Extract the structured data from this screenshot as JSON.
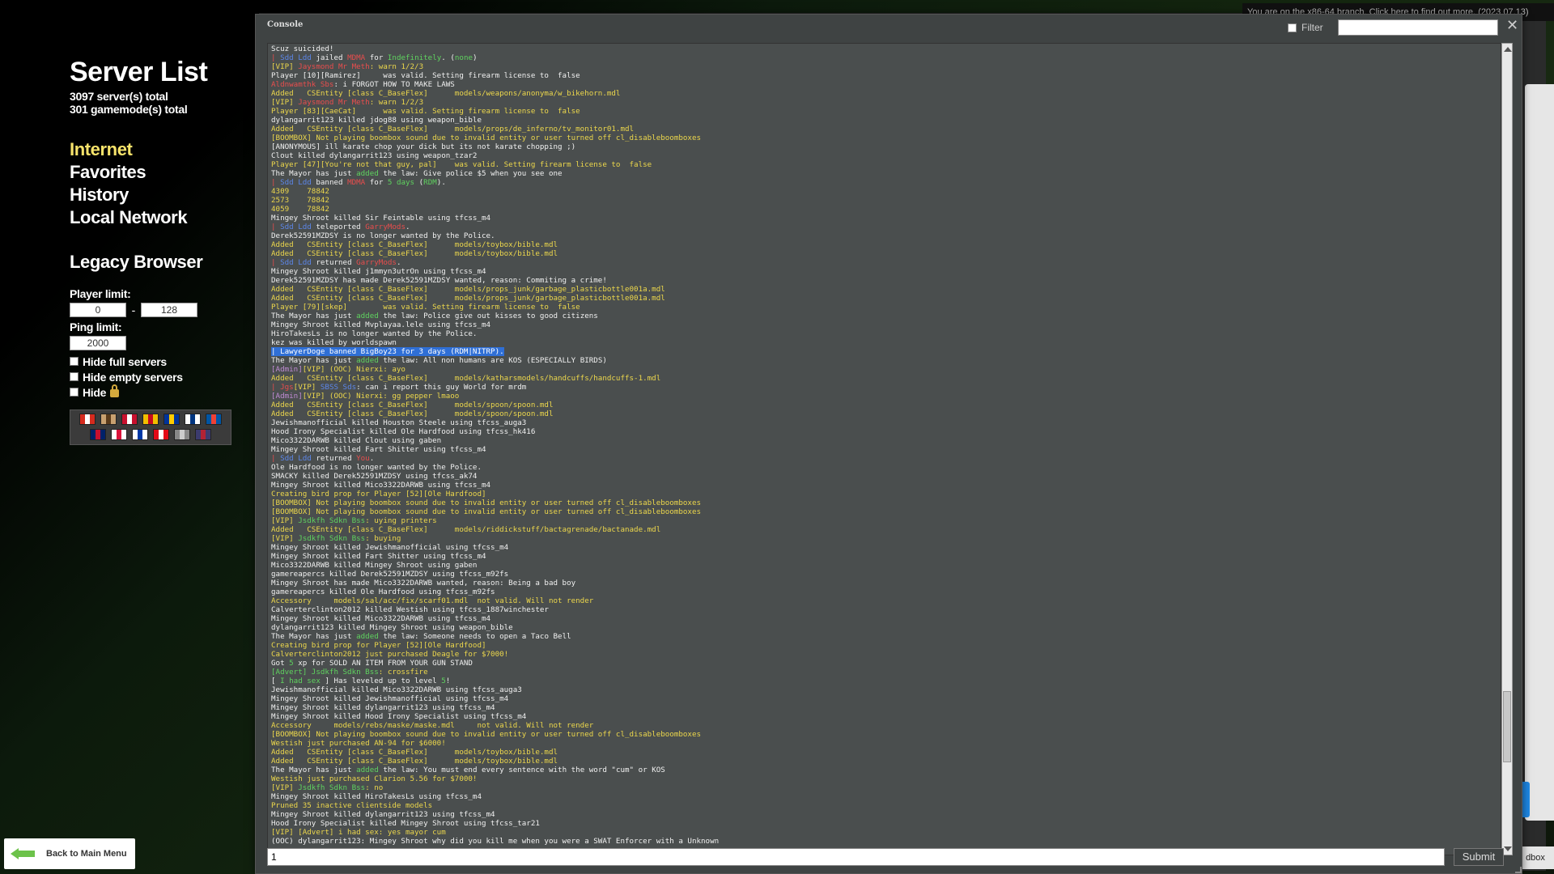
{
  "notice": "You are on the x86-64 branch. Click here to find out more. (2023.07.13)",
  "server_list": {
    "title": "Server List",
    "servers_total": "3097 server(s) total",
    "gamemodes_total": "301 gamemode(s) total",
    "nav": [
      "Internet",
      "Favorites",
      "History",
      "Local Network"
    ],
    "legacy": "Legacy Browser",
    "player_limit_label": "Player limit:",
    "player_limit_min": "0",
    "player_limit_max": "128",
    "dash": "-",
    "ping_limit_label": "Ping limit:",
    "ping_limit": "2000",
    "hide_full": "Hide full servers",
    "hide_empty": "Hide empty servers",
    "hide_locked": "Hide"
  },
  "back_button": "Back to Main Menu",
  "right_tab": "dbox",
  "console": {
    "title": "Console",
    "filter_label": "Filter",
    "filter_value": "",
    "command_value": "1",
    "submit": "Submit",
    "lines": [
      [
        [
          "w",
          "Scuz suicided!"
        ]
      ],
      [
        [
          "r",
          "| "
        ],
        [
          "b",
          "Sdd Ldd"
        ],
        [
          "w",
          " jailed "
        ],
        [
          "r",
          "MDMA"
        ],
        [
          "w",
          " for "
        ],
        [
          "g",
          "Indefinitely"
        ],
        [
          "w",
          ". ("
        ],
        [
          "g",
          "none"
        ],
        [
          "w",
          ")"
        ]
      ],
      [
        [
          "y",
          "[VIP] "
        ],
        [
          "r",
          "Jaysmond Mr Meth"
        ],
        [
          "y",
          ": warn 1/2/3"
        ]
      ],
      [
        [
          "w",
          "Player [10][Ramirez]     was valid. Setting firearm license to  false"
        ]
      ],
      [
        [
          "r",
          "Aldnwamthk Sbs"
        ],
        [
          "w",
          ": i FORGOT HOW TO MAKE LAWS"
        ]
      ],
      [
        [
          "y",
          "Added   CSEntity [class C_BaseFlex]      models/weapons/anonyma/w_bikehorn.mdl"
        ]
      ],
      [
        [
          "y",
          "[VIP] "
        ],
        [
          "r",
          "Jaysmond Mr Meth"
        ],
        [
          "y",
          ": warn 1/2/3"
        ]
      ],
      [
        [
          "y",
          "Player [83][CaeCat]      was valid. Setting firearm license to  false"
        ]
      ],
      [
        [
          "w",
          "dylangarrit123 killed jdog88 using weapon_bible"
        ]
      ],
      [
        [
          "y",
          "Added   CSEntity [class C_BaseFlex]      models/props/de_inferno/tv_monitor01.mdl"
        ]
      ],
      [
        [
          "y",
          "[BOOMBOX] Not playing boombox sound due to invalid entity or user turned off cl_disableboomboxes"
        ]
      ],
      [
        [
          "w",
          "[ANONYMOUS] ill karate chop your dick but its not karate chopping ;)"
        ]
      ],
      [
        [
          "w",
          "Clout killed dylangarrit123 using weapon_tzar2"
        ]
      ],
      [
        [
          "y",
          "Player [47][You're not that guy, pal]    was valid. Setting firearm license to  false"
        ]
      ],
      [
        [
          "w",
          "The Mayor has just "
        ],
        [
          "g",
          "added"
        ],
        [
          "w",
          " the law: Give police $5 when you see one"
        ]
      ],
      [
        [
          "r",
          "| "
        ],
        [
          "b",
          "Sdd Ldd"
        ],
        [
          "w",
          " banned "
        ],
        [
          "r",
          "MDMA"
        ],
        [
          "w",
          " for "
        ],
        [
          "g",
          "5 days"
        ],
        [
          "w",
          " ("
        ],
        [
          "g",
          "RDM"
        ],
        [
          "w",
          ")."
        ]
      ],
      [
        [
          "y",
          "4309    78842"
        ]
      ],
      [
        [
          "y",
          "2573    78842"
        ]
      ],
      [
        [
          "y",
          "4059    78842"
        ]
      ],
      [
        [
          "w",
          "Mingey Shroot killed Sir Feintable using tfcss_m4"
        ]
      ],
      [
        [
          "r",
          "| "
        ],
        [
          "b",
          "Sdd Ldd"
        ],
        [
          "w",
          " teleported "
        ],
        [
          "r",
          "GarryMods"
        ],
        [
          "w",
          "."
        ]
      ],
      [
        [
          "w",
          "Derek52591MZDSY is no longer wanted by the Police."
        ]
      ],
      [
        [
          "y",
          "Added   CSEntity [class C_BaseFlex]      models/toybox/bible.mdl"
        ]
      ],
      [
        [
          "y",
          "Added   CSEntity [class C_BaseFlex]      models/toybox/bible.mdl"
        ]
      ],
      [
        [
          "r",
          "| "
        ],
        [
          "b",
          "Sdd Ldd"
        ],
        [
          "w",
          " returned "
        ],
        [
          "r",
          "GarryMods"
        ],
        [
          "w",
          "."
        ]
      ],
      [
        [
          "w",
          "Mingey Shroot killed j1mmyn3utrOn using tfcss_m4"
        ]
      ],
      [
        [
          "w",
          "Derek52591MZDSY has made Derek52591MZDSY wanted, reason: Commiting a crime!"
        ]
      ],
      [
        [
          "y",
          "Added   CSEntity [class C_BaseFlex]      models/props_junk/garbage_plasticbottle001a.mdl"
        ]
      ],
      [
        [
          "y",
          "Added   CSEntity [class C_BaseFlex]      models/props_junk/garbage_plasticbottle001a.mdl"
        ]
      ],
      [
        [
          "y",
          "Player [79][skep]        was valid. Setting firearm license to  false"
        ]
      ],
      [
        [
          "w",
          "The Mayor has just "
        ],
        [
          "g",
          "added"
        ],
        [
          "w",
          " the law: Police give out kisses to good citizens"
        ]
      ],
      [
        [
          "w",
          "Mingey Shroot killed Mvplayaa.lele using tfcss_m4"
        ]
      ],
      [
        [
          "w",
          "HiroTakesLs is no longer wanted by the Police."
        ]
      ],
      [
        [
          "w",
          "kez was killed by worldspawn"
        ]
      ],
      [
        [
          "hl",
          "| LawyerDoge banned BigBoy23 for 3 days (RDM|NITRP)."
        ]
      ],
      [
        [
          "w",
          "The Mayor has just "
        ],
        [
          "g",
          "added"
        ],
        [
          "w",
          " the law: All non humans are KOS (ESPECIALLY BIRDS)"
        ]
      ],
      [
        [
          "p",
          "[Admin]"
        ],
        [
          "y",
          "[VIP] (OOC) Nierxi: ayo"
        ]
      ],
      [
        [
          "y",
          "Added   CSEntity [class C_BaseFlex]      models/katharsmodels/handcuffs/handcuffs-1.mdl"
        ]
      ],
      [
        [
          "r",
          "| Jgs"
        ],
        [
          "y",
          "[VIP] "
        ],
        [
          "b",
          "SBSS Sds"
        ],
        [
          "w",
          ": can i report this guy World for mrdm"
        ]
      ],
      [
        [
          "p",
          "[Admin]"
        ],
        [
          "y",
          "[VIP] (OOC) Nierxi: gg pepper lmaoo"
        ]
      ],
      [
        [
          "y",
          "Added   CSEntity [class C_BaseFlex]      models/spoon/spoon.mdl"
        ]
      ],
      [
        [
          "y",
          "Added   CSEntity [class C_BaseFlex]      models/spoon/spoon.mdl"
        ]
      ],
      [
        [
          "w",
          "Jewishmanofficial killed Houston Steele using tfcss_auga3"
        ]
      ],
      [
        [
          "w",
          "Hood Irony Specialist killed Ole Hardfood using tfcss_hk416"
        ]
      ],
      [
        [
          "w",
          "Mico3322DARWB killed Clout using gaben"
        ]
      ],
      [
        [
          "w",
          "Mingey Shroot killed Fart Shitter using tfcss_m4"
        ]
      ],
      [
        [
          "r",
          "| "
        ],
        [
          "b",
          "Sdd Ldd"
        ],
        [
          "w",
          " returned "
        ],
        [
          "r",
          "You"
        ],
        [
          "w",
          "."
        ]
      ],
      [
        [
          "w",
          "Ole Hardfood is no longer wanted by the Police."
        ]
      ],
      [
        [
          "w",
          "SMACKY killed Derek52591MZDSY using tfcss_ak74"
        ]
      ],
      [
        [
          "w",
          "Mingey Shroot killed Mico3322DARWB using tfcss_m4"
        ]
      ],
      [
        [
          "y",
          "Creating bird prop for Player [52][Ole Hardfood]"
        ]
      ],
      [
        [
          "y",
          "[BOOMBOX] Not playing boombox sound due to invalid entity or user turned off cl_disableboomboxes"
        ]
      ],
      [
        [
          "y",
          "[BOOMBOX] Not playing boombox sound due to invalid entity or user turned off cl_disableboomboxes"
        ]
      ],
      [
        [
          "y",
          "[VIP] "
        ],
        [
          "g",
          "Jsdkfh Sdkn Bss"
        ],
        [
          "y",
          ": uying printers"
        ]
      ],
      [
        [
          "y",
          "Added   CSEntity [class C_BaseFlex]      models/riddickstuff/bactagrenade/bactanade.mdl"
        ]
      ],
      [
        [
          "y",
          "[VIP] "
        ],
        [
          "g",
          "Jsdkfh Sdkn Bss"
        ],
        [
          "y",
          ": buying"
        ]
      ],
      [
        [
          "w",
          "Mingey Shroot killed Jewishmanofficial using tfcss_m4"
        ]
      ],
      [
        [
          "w",
          "Mingey Shroot killed Fart Shitter using tfcss_m4"
        ]
      ],
      [
        [
          "w",
          "Mico3322DARWB killed Mingey Shroot using gaben"
        ]
      ],
      [
        [
          "w",
          "gamereapercs killed Derek52591MZDSY using tfcss_m92fs"
        ]
      ],
      [
        [
          "w",
          "Mingey Shroot has made Mico3322DARWB wanted, reason: Being a bad boy"
        ]
      ],
      [
        [
          "w",
          "gamereapercs killed Ole Hardfood using tfcss_m92fs"
        ]
      ],
      [
        [
          "y",
          "Accessory     models/sal/acc/fix/scarf01.mdl  not valid. Will not render"
        ]
      ],
      [
        [
          "w",
          "Calverterclinton2012 killed Westish using tfcss_1887winchester"
        ]
      ],
      [
        [
          "w",
          "Mingey Shroot killed Mico3322DARWB using tfcss_m4"
        ]
      ],
      [
        [
          "w",
          "dylangarrit123 killed Mingey Shroot using weapon_bible"
        ]
      ],
      [
        [
          "w",
          "The Mayor has just "
        ],
        [
          "g",
          "added"
        ],
        [
          "w",
          " the law: Someone needs to open a Taco Bell"
        ]
      ],
      [
        [
          "y",
          "Creating bird prop for Player [52][Ole Hardfood]"
        ]
      ],
      [
        [
          "y",
          "Calverterclinton2012 just purchased Deagle for $7000!"
        ]
      ],
      [
        [
          "w",
          "Got "
        ],
        [
          "g",
          "5"
        ],
        [
          "w",
          " xp for SOLD AN ITEM FROM YOUR GUN STAND"
        ]
      ],
      [
        [
          "g",
          "[Advert] Jsdkfh Sdkn Bss"
        ],
        [
          "y",
          ": crossfire"
        ]
      ],
      [
        [
          "w",
          "[ "
        ],
        [
          "g",
          "I had sex"
        ],
        [
          "w",
          " ] Has leveled up to level "
        ],
        [
          "g",
          "5"
        ],
        [
          "w",
          "!"
        ]
      ],
      [
        [
          "w",
          "Jewishmanofficial killed Mico3322DARWB using tfcss_auga3"
        ]
      ],
      [
        [
          "w",
          "Mingey Shroot killed Jewishmanofficial using tfcss_m4"
        ]
      ],
      [
        [
          "w",
          "Mingey Shroot killed dylangarrit123 using tfcss_m4"
        ]
      ],
      [
        [
          "w",
          "Mingey Shroot killed Hood Irony Specialist using tfcss_m4"
        ]
      ],
      [
        [
          "y",
          "Accessory     models/rebs/maske/maske.mdl     not valid. Will not render"
        ]
      ],
      [
        [
          "y",
          "[BOOMBOX] Not playing boombox sound due to invalid entity or user turned off cl_disableboomboxes"
        ]
      ],
      [
        [
          "y",
          "Westish just purchased AN-94 for $6000!"
        ]
      ],
      [
        [
          "y",
          "Added   CSEntity [class C_BaseFlex]      models/toybox/bible.mdl"
        ]
      ],
      [
        [
          "y",
          "Added   CSEntity [class C_BaseFlex]      models/toybox/bible.mdl"
        ]
      ],
      [
        [
          "w",
          "The Mayor has just "
        ],
        [
          "g",
          "added"
        ],
        [
          "w",
          " the law: You must end every sentence with the word \"cum\" or KOS"
        ]
      ],
      [
        [
          "y",
          "Westish just purchased Clarion 5.56 for $7000!"
        ]
      ],
      [
        [
          "y",
          "[VIP] "
        ],
        [
          "g",
          "Jsdkfh Sdkn Bss"
        ],
        [
          "y",
          ": no"
        ]
      ],
      [
        [
          "w",
          "Mingey Shroot killed HiroTakesLs using tfcss_m4"
        ]
      ],
      [
        [
          "y",
          "Pruned 35 inactive clientside models"
        ]
      ],
      [
        [
          "w",
          "Mingey Shroot killed dylangarrit123 using tfcss_m4"
        ]
      ],
      [
        [
          "w",
          "Hood Irony Specialist killed Mingey Shroot using tfcss_tar21"
        ]
      ],
      [
        [
          "y",
          "[VIP] [Advert] i had sex: yes mayor cum"
        ]
      ],
      [
        [
          "w",
          "(OOC) dylangarrit123: Mingey Shroot why did you kill me when you were a SWAT Enforcer with a Unknown"
        ]
      ]
    ]
  },
  "colors": {
    "w": "#f0f0f0",
    "y": "#ecd74c",
    "r": "#e84d4d",
    "g": "#5fd25f",
    "b": "#5c86e8",
    "p": "#c08bd4",
    "accent_active_nav": "#f7e36b"
  },
  "flags": [
    [
      "#d52b1e",
      "#ffffff"
    ],
    [
      "#c8a070",
      "#5a3a1a"
    ],
    [
      "#c8102e",
      "#ffffff"
    ],
    [
      "#f1bf00",
      "#c60b1e"
    ],
    [
      "#003399",
      "#ffcc00"
    ],
    [
      "#ffffff",
      "#003580"
    ],
    [
      "#0055a4",
      "#ef4135"
    ],
    [
      "#012169",
      "#c8102e"
    ],
    [
      "#ffffff",
      "#dc143c"
    ],
    [
      "#ffffff",
      "#0039a6"
    ],
    [
      "#e30a17",
      "#ffffff"
    ],
    [
      "#888888",
      "#cccccc"
    ],
    [
      "#3c3b6e",
      "#b22234"
    ]
  ]
}
